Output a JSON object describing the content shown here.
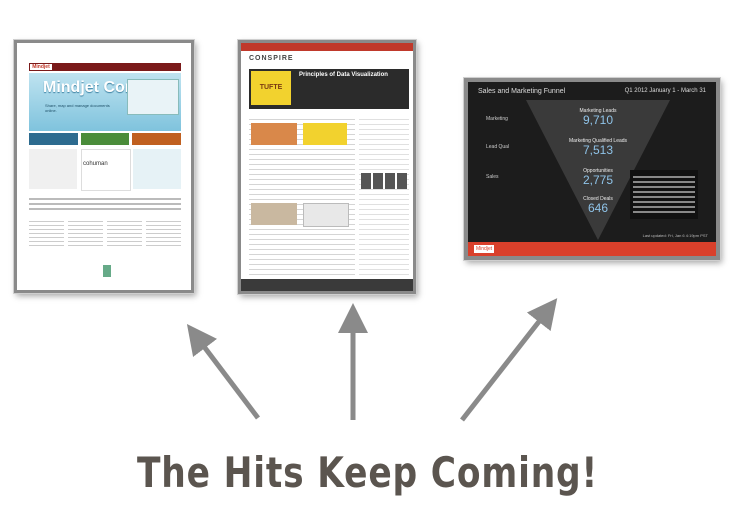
{
  "headline": "The Hits Keep Coming!",
  "colors": {
    "arrow": "#8a8a8a",
    "headline": "#5b554f",
    "dashboard_accent": "#d9402b"
  },
  "thumb1": {
    "logo": "Mindjet",
    "hero_title": "Mindjet Connect",
    "hero_sub": "Share, map and manage documents online.",
    "partner": "cohuman"
  },
  "thumb2": {
    "brand": "CONSPIRE",
    "feature_title": "Principles of Data Visualization",
    "feature_badge": "TUFTE"
  },
  "thumb3": {
    "title": "Sales and Marketing Funnel",
    "period": "Q1 2012   January 1 - March 31",
    "metrics": [
      {
        "label": "Marketing Leads",
        "value": "9,710"
      },
      {
        "label": "Marketing Qualified Leads",
        "value": "7,513"
      },
      {
        "label": "Opportunities",
        "value": "2,775"
      },
      {
        "label": "Closed Deals",
        "value": "646"
      }
    ],
    "rows": [
      "Marketing",
      "Lead Qual",
      "Sales"
    ],
    "logo": "Mindjet",
    "updated": "Last updated: Fri, Jan 6 4:19pm PST"
  }
}
